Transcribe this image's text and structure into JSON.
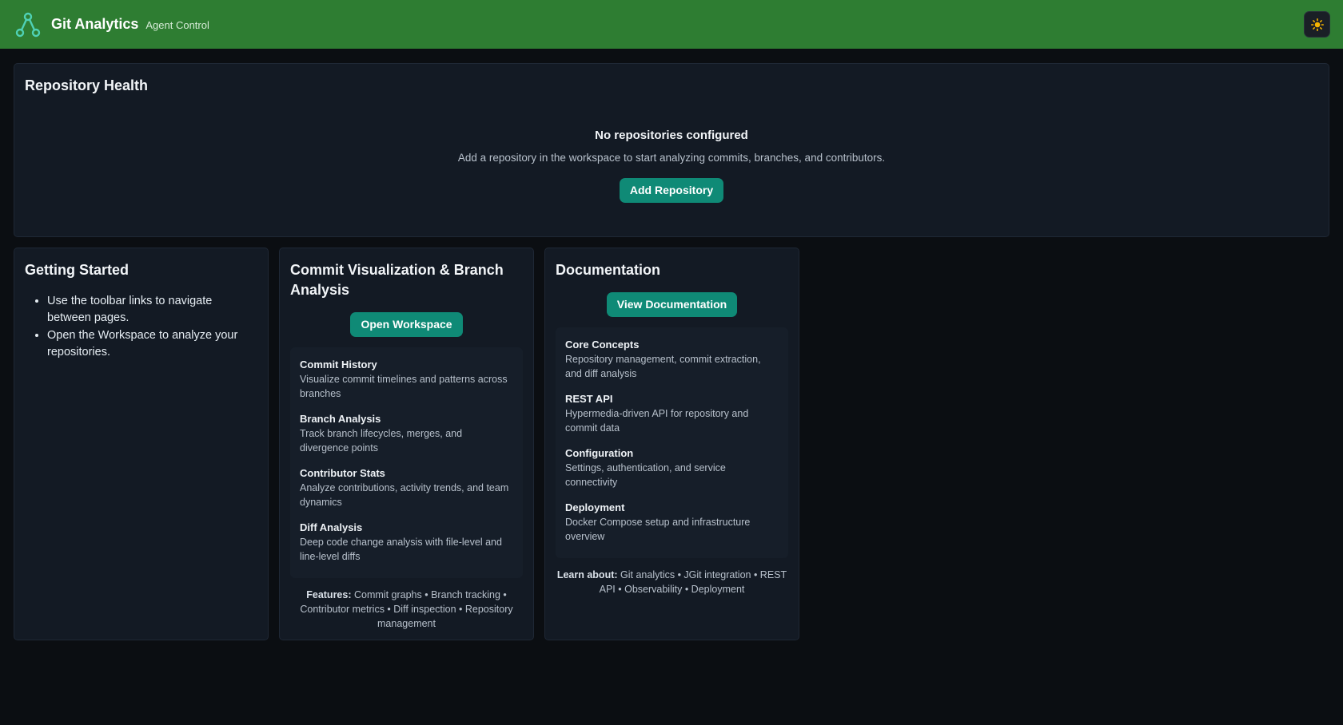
{
  "header": {
    "title": "Git Analytics",
    "subtitle": "Agent Control",
    "theme_icon": "sun-icon",
    "bg_color": "#2e7d32"
  },
  "repository_health": {
    "title": "Repository Health",
    "empty_title": "No repositories configured",
    "empty_description": "Add a repository in the workspace to start analyzing commits, branches, and contributors.",
    "add_button": "Add Repository"
  },
  "getting_started": {
    "title": "Getting Started",
    "items": [
      "Use the toolbar links to navigate between pages.",
      "Open the Workspace to analyze your repositories."
    ]
  },
  "commit_viz": {
    "title": "Commit Visualization & Branch Analysis",
    "button": "Open Workspace",
    "features": [
      {
        "title": "Commit History",
        "desc": "Visualize commit timelines and patterns across branches"
      },
      {
        "title": "Branch Analysis",
        "desc": "Track branch lifecycles, merges, and divergence points"
      },
      {
        "title": "Contributor Stats",
        "desc": "Analyze contributions, activity trends, and team dynamics"
      },
      {
        "title": "Diff Analysis",
        "desc": "Deep code change analysis with file-level and line-level diffs"
      }
    ],
    "footer_label": "Features:",
    "footer_text": "Commit graphs • Branch tracking • Contributor metrics • Diff inspection • Repository management"
  },
  "documentation": {
    "title": "Documentation",
    "button": "View Documentation",
    "topics": [
      {
        "title": "Core Concepts",
        "desc": "Repository management, commit extraction, and diff analysis"
      },
      {
        "title": "REST API",
        "desc": "Hypermedia-driven API for repository and commit data"
      },
      {
        "title": "Configuration",
        "desc": "Settings, authentication, and service connectivity"
      },
      {
        "title": "Deployment",
        "desc": "Docker Compose setup and infrastructure overview"
      }
    ],
    "footer_label": "Learn about:",
    "footer_text": "Git analytics • JGit integration • REST API • Observability • Deployment"
  },
  "colors": {
    "accent": "#0f8a76",
    "background": "#0b0e12",
    "card": "#131a24"
  }
}
